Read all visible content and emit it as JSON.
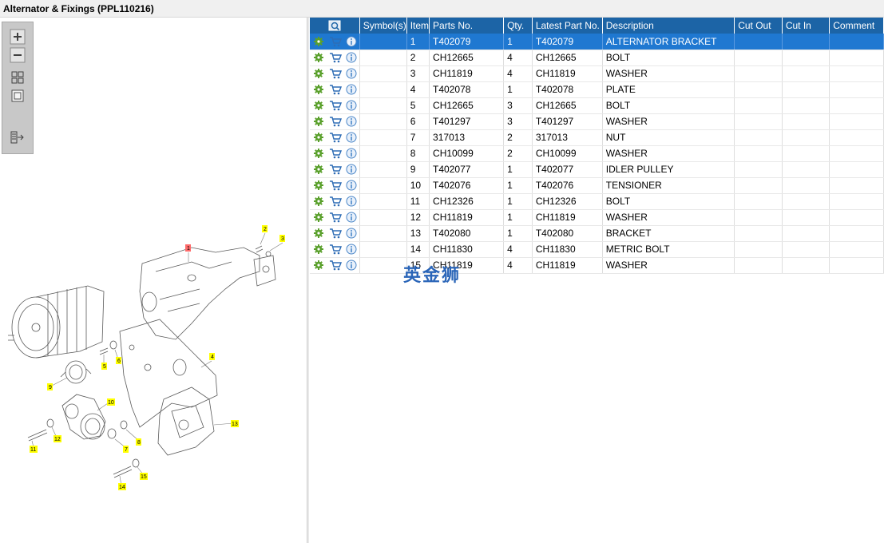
{
  "window": {
    "title": "Alternator & Fixings (PPL110216)"
  },
  "toolbar": {
    "items": [
      {
        "name": "zoom-in-icon"
      },
      {
        "name": "zoom-out-icon"
      },
      {
        "name": "fit-all-icon"
      },
      {
        "name": "actual-size-icon"
      },
      {
        "name": "list-export-icon"
      }
    ]
  },
  "diagram": {
    "callouts": [
      "1",
      "2",
      "3",
      "4",
      "5",
      "6",
      "7",
      "8",
      "9",
      "10",
      "11",
      "12",
      "13",
      "14",
      "15"
    ],
    "colors": {
      "callout_bg": "#ffff00",
      "selected_callout_bg": "#ff6b6b",
      "line": "#5a5a5a"
    }
  },
  "grid": {
    "columns": [
      "",
      "Symbol(s)",
      "Item",
      "Parts No.",
      "Qty.",
      "Latest Part No.",
      "Description",
      "Cut Out",
      "Cut In",
      "Comment"
    ],
    "rows": [
      {
        "item": "1",
        "part_no": "T402079",
        "qty": "1",
        "latest": "T402079",
        "desc": "ALTERNATOR BRACKET"
      },
      {
        "item": "2",
        "part_no": "CH12665",
        "qty": "4",
        "latest": "CH12665",
        "desc": "BOLT"
      },
      {
        "item": "3",
        "part_no": "CH11819",
        "qty": "4",
        "latest": "CH11819",
        "desc": "WASHER"
      },
      {
        "item": "4",
        "part_no": "T402078",
        "qty": "1",
        "latest": "T402078",
        "desc": "PLATE"
      },
      {
        "item": "5",
        "part_no": "CH12665",
        "qty": "3",
        "latest": "CH12665",
        "desc": "BOLT"
      },
      {
        "item": "6",
        "part_no": "T401297",
        "qty": "3",
        "latest": "T401297",
        "desc": "WASHER"
      },
      {
        "item": "7",
        "part_no": "317013",
        "qty": "2",
        "latest": "317013",
        "desc": "NUT"
      },
      {
        "item": "8",
        "part_no": "CH10099",
        "qty": "2",
        "latest": "CH10099",
        "desc": "WASHER"
      },
      {
        "item": "9",
        "part_no": "T402077",
        "qty": "1",
        "latest": "T402077",
        "desc": "IDLER PULLEY"
      },
      {
        "item": "10",
        "part_no": "T402076",
        "qty": "1",
        "latest": "T402076",
        "desc": "TENSIONER"
      },
      {
        "item": "11",
        "part_no": "CH12326",
        "qty": "1",
        "latest": "CH12326",
        "desc": "BOLT"
      },
      {
        "item": "12",
        "part_no": "CH11819",
        "qty": "1",
        "latest": "CH11819",
        "desc": "WASHER"
      },
      {
        "item": "13",
        "part_no": "T402080",
        "qty": "1",
        "latest": "T402080",
        "desc": "BRACKET"
      },
      {
        "item": "14",
        "part_no": "CH11830",
        "qty": "4",
        "latest": "CH11830",
        "desc": "METRIC BOLT"
      },
      {
        "item": "15",
        "part_no": "CH11819",
        "qty": "4",
        "latest": "CH11819",
        "desc": "WASHER"
      }
    ],
    "row_icons": [
      "gear-icon",
      "cart-icon",
      "info-icon"
    ],
    "colors": {
      "header_bg": "#1c64a6",
      "selected_bg": "#1f78d1",
      "gear": "#5aa02c",
      "cart": "#2f6db5",
      "info": "#4a86c8"
    }
  },
  "watermark": {
    "text": "英金狮"
  }
}
